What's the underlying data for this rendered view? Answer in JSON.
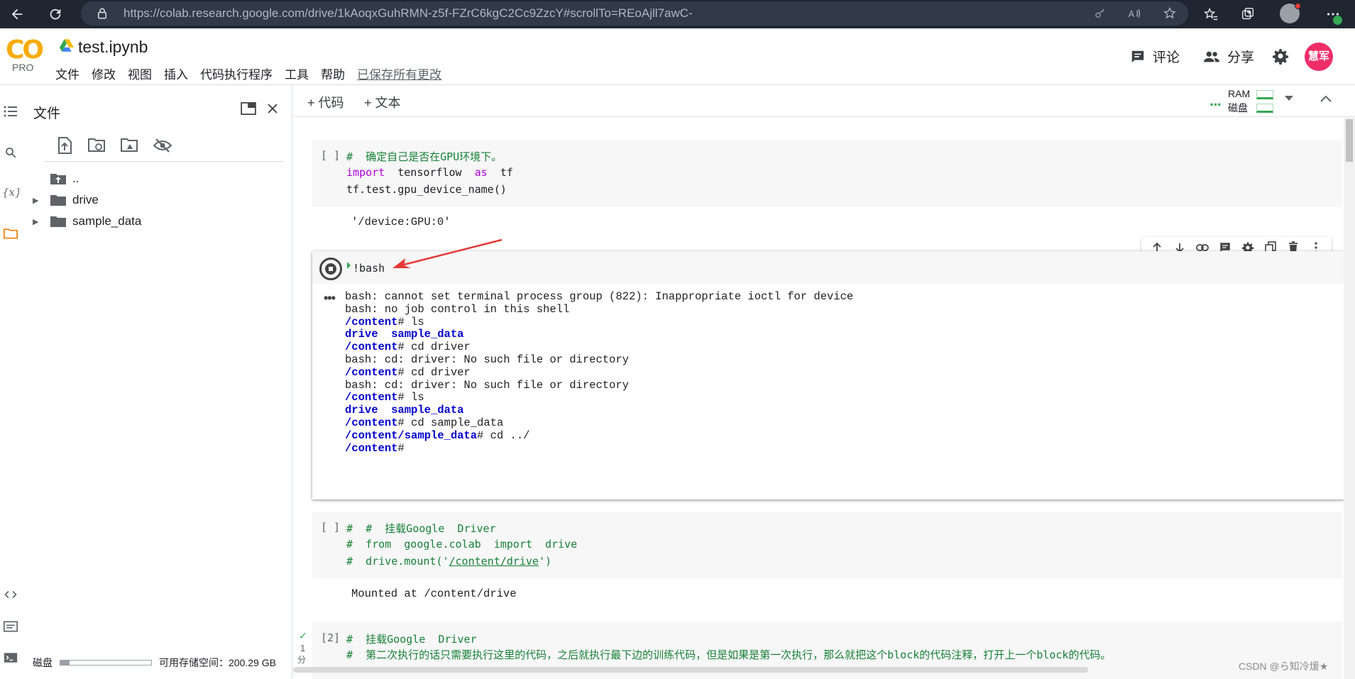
{
  "browser": {
    "url": "https://colab.research.google.com/drive/1kAoqxGuhRMN-z5f-FZrC6kgC2Cc9ZzcY#scrollTo=REoAjll7awC-"
  },
  "header": {
    "logo": "CO",
    "plan": "PRO",
    "doc_title": "test.ipynb",
    "menu": [
      "文件",
      "修改",
      "视图",
      "插入",
      "代码执行程序",
      "工具",
      "帮助"
    ],
    "saved_status": "已保存所有更改",
    "comment_label": "评论",
    "share_label": "分享",
    "user_badge": "慧军"
  },
  "file_panel": {
    "title": "文件",
    "tree": [
      {
        "name": "..",
        "type": "parent"
      },
      {
        "name": "drive",
        "type": "folder"
      },
      {
        "name": "sample_data",
        "type": "folder"
      }
    ],
    "disk_label": "磁盘",
    "disk_fill": 0.1,
    "disk_free": "可用存储空间：200.29 GB"
  },
  "notebook_toolbar": {
    "add_code": "+ 代码",
    "add_text": "+ 文本",
    "ram_label": "RAM",
    "disk_label": "磁盘"
  },
  "cells": {
    "cell1": {
      "count": "[ ]",
      "line1": "#  确定自己是否在GPU环境下。",
      "line2_kw1": "import",
      "line2_mid": "  tensorflow  ",
      "line2_kw2": "as",
      "line2_end": "  tf",
      "line3": "tf.test.gpu_device_name()",
      "output": "'/device:GPU:0'"
    },
    "cell2": {
      "code": "!bash",
      "output": [
        [
          "",
          "bash: cannot set terminal process group (822): Inappropriate ioctl for device"
        ],
        [
          "",
          "bash: no job control in this shell"
        ],
        [
          "/content",
          "# ls"
        ],
        [
          "drive  sample_data",
          ""
        ],
        [
          "/content",
          "# cd driver"
        ],
        [
          "",
          "bash: cd: driver: No such file or directory"
        ],
        [
          "/content",
          "# cd driver"
        ],
        [
          "",
          "bash: cd: driver: No such file or directory"
        ],
        [
          "/content",
          "# ls"
        ],
        [
          "drive  sample_data",
          ""
        ],
        [
          "/content",
          "# cd sample_data"
        ],
        [
          "/content/sample_data",
          "# cd ../"
        ],
        [
          "/content",
          "#"
        ]
      ]
    },
    "cell3": {
      "count": "[ ]",
      "line1": "#  #  挂载Google  Driver",
      "line2": "#  from  google.colab  import  drive",
      "line3a": "#  drive.mount('",
      "line3b": "/content/drive",
      "line3c": "')",
      "output": "Mounted at /content/drive"
    },
    "cell4": {
      "count": "[2]",
      "line1": "#  挂载Google  Driver",
      "line2": "#  第二次执行的话只需要执行这里的代码，之后就执行最下边的训练代码，但是如果是第一次执行，那么就把这个block的代码注释，打开上一个block的代码。",
      "status_num": "1",
      "status_unit": "分"
    }
  },
  "watermark": "CSDN @ら知冷煖★"
}
